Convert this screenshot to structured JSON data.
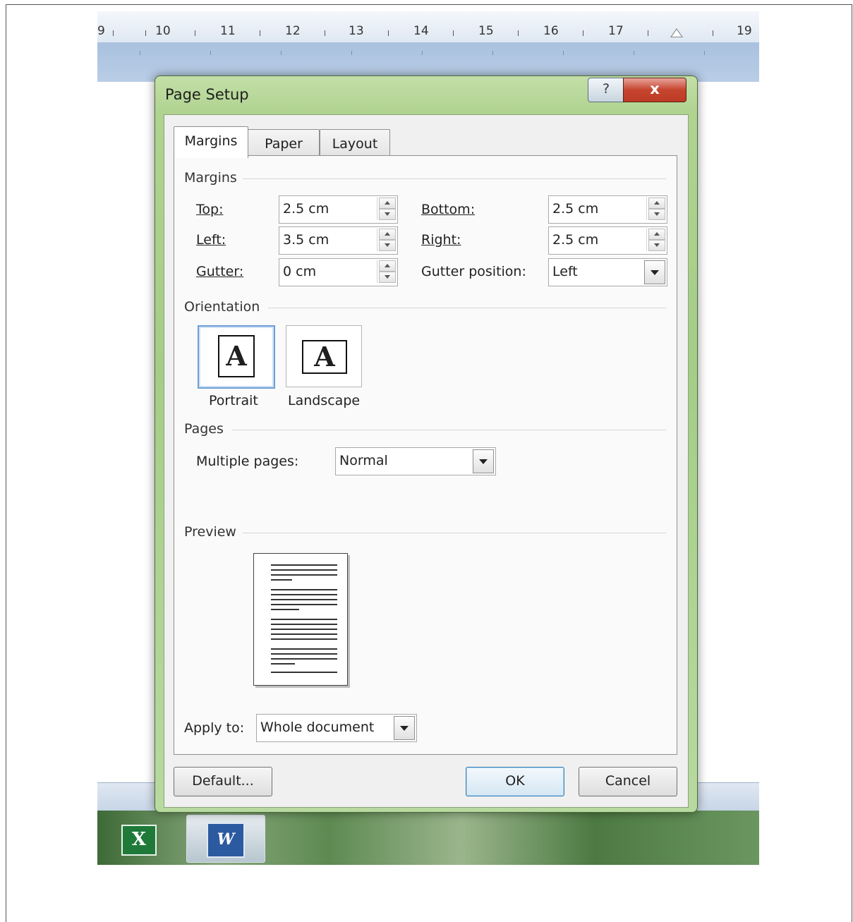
{
  "ruler": {
    "numbers": [
      "9",
      "10",
      "11",
      "12",
      "13",
      "14",
      "15",
      "16",
      "17",
      "19"
    ]
  },
  "dialog": {
    "title": "Page Setup",
    "help_symbol": "?",
    "close_symbol": "x",
    "tabs": [
      {
        "label": "Margins",
        "active": true
      },
      {
        "label": "Paper",
        "active": false
      },
      {
        "label": "Layout",
        "active": false
      }
    ],
    "margins": {
      "group_label": "Margins",
      "top_label": "Top:",
      "top_value": "2.5 cm",
      "bottom_label": "Bottom:",
      "bottom_value": "2.5 cm",
      "left_label": "Left:",
      "left_value": "3.5 cm",
      "right_label": "Right:",
      "right_value": "2.5 cm",
      "gutter_label": "Gutter:",
      "gutter_value": "0 cm",
      "gutter_position_label": "Gutter position:",
      "gutter_position_value": "Left"
    },
    "orientation": {
      "group_label": "Orientation",
      "portrait_label": "Portrait",
      "landscape_label": "Landscape",
      "icon_letter": "A",
      "selected": "Portrait"
    },
    "pages": {
      "group_label": "Pages",
      "multiple_pages_label": "Multiple pages:",
      "multiple_pages_value": "Normal"
    },
    "preview": {
      "group_label": "Preview"
    },
    "apply_to": {
      "label": "Apply to:",
      "value": "Whole document"
    },
    "buttons": {
      "default_label": "Default...",
      "ok_label": "OK",
      "cancel_label": "Cancel"
    }
  },
  "taskbar": {
    "excel_icon_letter": "X",
    "word_icon_letter": "W"
  }
}
